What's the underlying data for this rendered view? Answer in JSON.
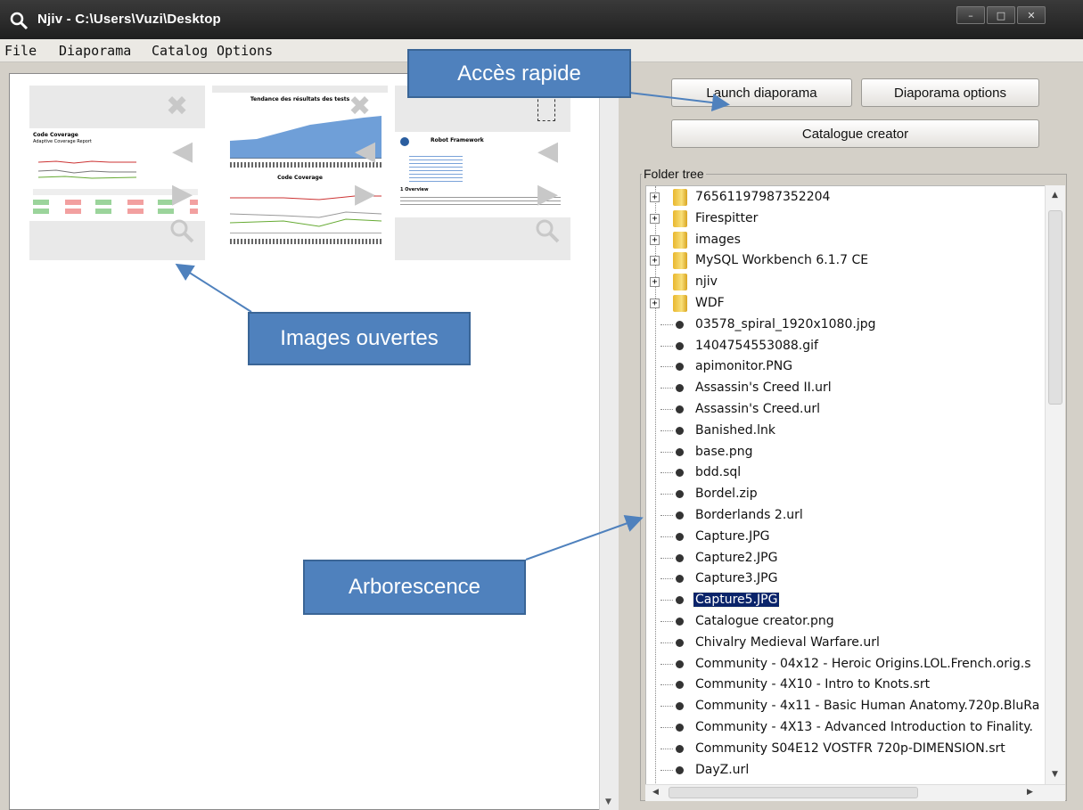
{
  "window": {
    "title": "Njiv - C:\\Users\\Vuzi\\Desktop",
    "controls": [
      "–",
      "□",
      "✕"
    ]
  },
  "menu": [
    "File",
    "Diaporama",
    "Catalog",
    "Options"
  ],
  "thumbnails": [
    {
      "title": "Code Coverage",
      "subtitle": "Adaptive Coverage Report"
    },
    {
      "title": "Tendance des résultats des tests",
      "subtitle": "Code Coverage"
    },
    {
      "title": "Robot Framework",
      "subtitle": "1 Overview"
    }
  ],
  "buttons": {
    "launch": "Launch diaporama",
    "options": "Diaporama options",
    "catalogue": "Catalogue creator"
  },
  "folder_tree": {
    "label": "Folder tree",
    "items": [
      {
        "label": "76561197987352204",
        "type": "folder"
      },
      {
        "label": "Firespitter",
        "type": "folder"
      },
      {
        "label": "images",
        "type": "folder"
      },
      {
        "label": "MySQL Workbench 6.1.7 CE",
        "type": "folder"
      },
      {
        "label": "njiv",
        "type": "folder"
      },
      {
        "label": "WDF",
        "type": "folder"
      },
      {
        "label": "03578_spiral_1920x1080.jpg",
        "type": "file"
      },
      {
        "label": "1404754553088.gif",
        "type": "file"
      },
      {
        "label": "apimonitor.PNG",
        "type": "file"
      },
      {
        "label": "Assassin's Creed II.url",
        "type": "file"
      },
      {
        "label": "Assassin's Creed.url",
        "type": "file"
      },
      {
        "label": "Banished.lnk",
        "type": "file"
      },
      {
        "label": "base.png",
        "type": "file"
      },
      {
        "label": "bdd.sql",
        "type": "file"
      },
      {
        "label": "Bordel.zip",
        "type": "file"
      },
      {
        "label": "Borderlands 2.url",
        "type": "file"
      },
      {
        "label": "Capture.JPG",
        "type": "file"
      },
      {
        "label": "Capture2.JPG",
        "type": "file"
      },
      {
        "label": "Capture3.JPG",
        "type": "file"
      },
      {
        "label": "Capture5.JPG",
        "type": "file",
        "selected": true
      },
      {
        "label": "Catalogue creator.png",
        "type": "file"
      },
      {
        "label": "Chivalry Medieval Warfare.url",
        "type": "file"
      },
      {
        "label": "Community - 04x12 - Heroic Origins.LOL.French.orig.s",
        "type": "file"
      },
      {
        "label": "Community - 4X10 - Intro to Knots.srt",
        "type": "file"
      },
      {
        "label": "Community - 4x11 - Basic Human Anatomy.720p.BluRa",
        "type": "file"
      },
      {
        "label": "Community - 4X13 - Advanced Introduction to Finality.",
        "type": "file"
      },
      {
        "label": "Community S04E12 VOSTFR 720p-DIMENSION.srt",
        "type": "file"
      },
      {
        "label": "DayZ.url",
        "type": "file"
      }
    ]
  },
  "callouts": {
    "quick_access": "Accès rapide",
    "open_images": "Images ouvertes",
    "tree": "Arborescence"
  },
  "colors": {
    "callout": "#4f81bd",
    "selection": "#0a246a",
    "titlebar": "#2b2b2b"
  }
}
